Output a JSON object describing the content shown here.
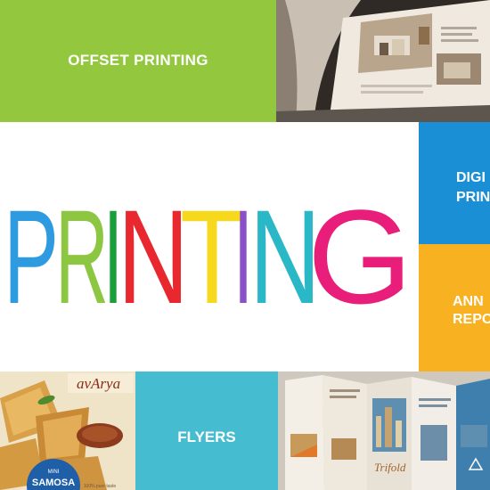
{
  "tiles": {
    "offset_label": "OFFSET PRINTING",
    "digital_label_line1": "DIGI",
    "digital_label_line2": "PRINT",
    "annual_label_line1": "ANN",
    "annual_label_line2": "REPO",
    "flyers_label": "FLYERS"
  },
  "headline": {
    "letters": [
      "P",
      "R",
      "I",
      "N",
      "T",
      "I",
      "N",
      "G"
    ]
  },
  "samosa": {
    "brand": "avArya",
    "badge_top": "MINI",
    "badge_main": "SAMOSA",
    "footnote": "100% pure taste"
  },
  "brochure": {
    "panel_text": "Trifold"
  },
  "colors": {
    "green": "#93c83e",
    "blue": "#1b8fd6",
    "orange": "#f7b121",
    "cyan": "#45bcd0"
  }
}
